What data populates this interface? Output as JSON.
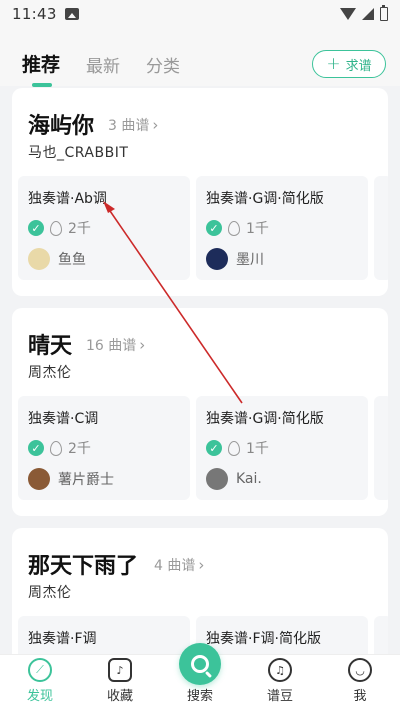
{
  "status": {
    "time": "11:43"
  },
  "header": {
    "tabs": [
      {
        "label": "推荐",
        "active": true
      },
      {
        "label": "最新",
        "active": false
      },
      {
        "label": "分类",
        "active": false
      }
    ],
    "request_button": "求谱"
  },
  "songs": [
    {
      "title": "海屿你",
      "count": "3 曲谱",
      "artist": "马也_CRABBIT",
      "scores": [
        {
          "name": "独奏谱·Ab调",
          "heat": "2千",
          "user": "鱼鱼"
        },
        {
          "name": "独奏谱·G调·简化版",
          "heat": "1千",
          "user": "墨川"
        }
      ]
    },
    {
      "title": "晴天",
      "count": "16 曲谱",
      "artist": "周杰伦",
      "scores": [
        {
          "name": "独奏谱·C调",
          "heat": "2千",
          "user": "薯片爵士"
        },
        {
          "name": "独奏谱·G调·简化版",
          "heat": "1千",
          "user": "Kai."
        }
      ]
    },
    {
      "title": "那天下雨了",
      "count": "4 曲谱",
      "artist": "周杰伦",
      "scores": [
        {
          "name": "独奏谱·F调",
          "heat": "",
          "user": ""
        },
        {
          "name": "独奏谱·F调·简化版",
          "heat": "",
          "user": ""
        }
      ]
    }
  ],
  "bottom_nav": [
    {
      "label": "发现",
      "icon": "compass-icon",
      "active": true
    },
    {
      "label": "收藏",
      "icon": "music-note-icon",
      "active": false
    },
    {
      "label": "搜索",
      "icon": "search-icon",
      "active": false
    },
    {
      "label": "谱豆",
      "icon": "bean-icon",
      "active": false
    },
    {
      "label": "我",
      "icon": "smile-icon",
      "active": false
    }
  ],
  "colors": {
    "accent": "#3cc39a",
    "annotation_arrow": "#cc2a2a"
  }
}
